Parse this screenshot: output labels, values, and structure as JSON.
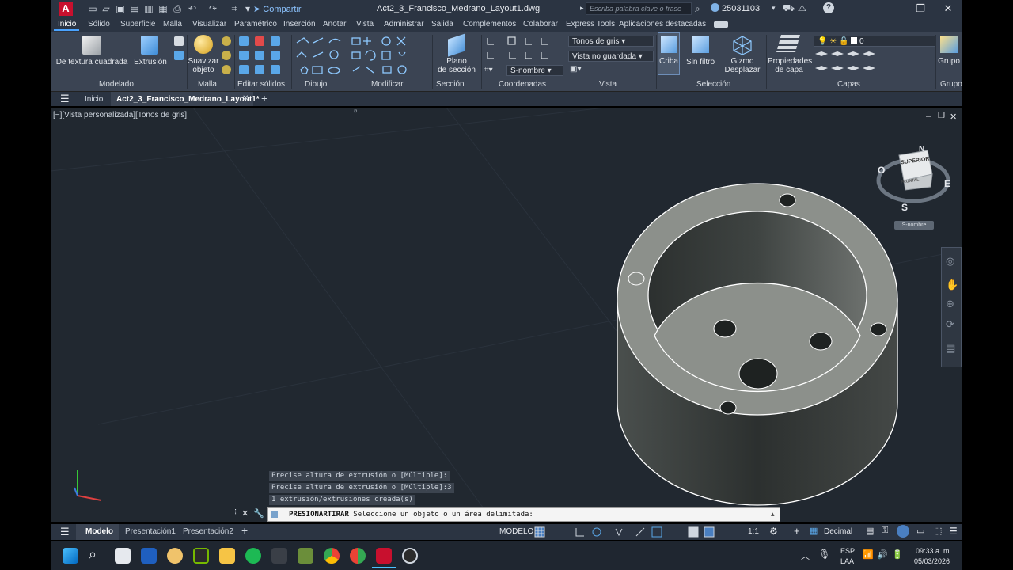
{
  "titlebar": {
    "app_letter": "A",
    "share_label": "Compartir",
    "document_title": "Act2_3_Francisco_Medrano_Layout1.dwg",
    "search_placeholder": "Escriba palabra clave o frase",
    "user_id": "25031103"
  },
  "ribbon_tabs": [
    "Inicio",
    "Sólido",
    "Superficie",
    "Malla",
    "Visualizar",
    "Paramétrico",
    "Inserción",
    "Anotar",
    "Vista",
    "Administrar",
    "Salida",
    "Complementos",
    "Colaborar",
    "Express Tools",
    "Aplicaciones destacadas"
  ],
  "ribbon": {
    "modelado": {
      "label": "Modelado",
      "btn1": "De textura cuadrada",
      "btn2": "Extrusión"
    },
    "malla": {
      "label": "Malla",
      "btn1_line1": "Suavizar",
      "btn1_line2": "objeto"
    },
    "editar_solidos": {
      "label": "Editar sólidos"
    },
    "dibujo": {
      "label": "Dibujo"
    },
    "modificar": {
      "label": "Modificar"
    },
    "seccion": {
      "label": "Sección",
      "btn_line1": "Plano",
      "btn_line2": "de sección"
    },
    "coordenadas": {
      "label": "Coordenadas",
      "ucs_value": "S-nombre"
    },
    "vista": {
      "label": "Vista",
      "visual_style": "Tonos de gris",
      "saved_view": "Vista no guardada"
    },
    "seleccion": {
      "label": "Selección",
      "btn1": "Criba",
      "btn2": "Sin filtro",
      "btn3_line1": "Gizmo",
      "btn3_line2": "Desplazar"
    },
    "capas": {
      "label": "Capas",
      "btn_line1": "Propiedades",
      "btn_line2": "de capa",
      "layer_value": "0"
    },
    "grupos": {
      "label": "Grupos",
      "btn": "Grupo"
    }
  },
  "file_tabs": {
    "home": "Inicio",
    "active": "Act2_3_Francisco_Medrano_Layout1*"
  },
  "viewport": {
    "label": "[−][Vista personalizada][Tonos de gris]",
    "viewcube": {
      "top": "SUPERIOR",
      "front": "FRONTAL",
      "north": "N",
      "east": "E",
      "south": "S",
      "west": "O",
      "ucs": "S-nombre"
    }
  },
  "command": {
    "history": [
      "Precise altura de extrusión o [Múltiple]:",
      "Precise altura de extrusión o [Múltiple]:3",
      "1 extrusión/extrusiones creada(s)"
    ],
    "prompt_strong": "PRESIONARTIRAR",
    "prompt_text": " Seleccione un objeto o un área delimitada:"
  },
  "status_bar": {
    "layouts": [
      "Modelo",
      "Presentación1",
      "Presentación2"
    ],
    "mode": "MODELO",
    "scale": "1:1",
    "units": "Decimal"
  },
  "taskbar": {
    "lang1": "ESP",
    "lang2": "LAA",
    "time": "09:33 a. m.",
    "date": "05/03/2026"
  },
  "colors": {
    "accent": "#4aa3ff",
    "ribbon_bg": "#3b4453",
    "viewport_bg": "#212830",
    "solid_top": "#8d918c",
    "solid_side": "#3a3e3d"
  }
}
